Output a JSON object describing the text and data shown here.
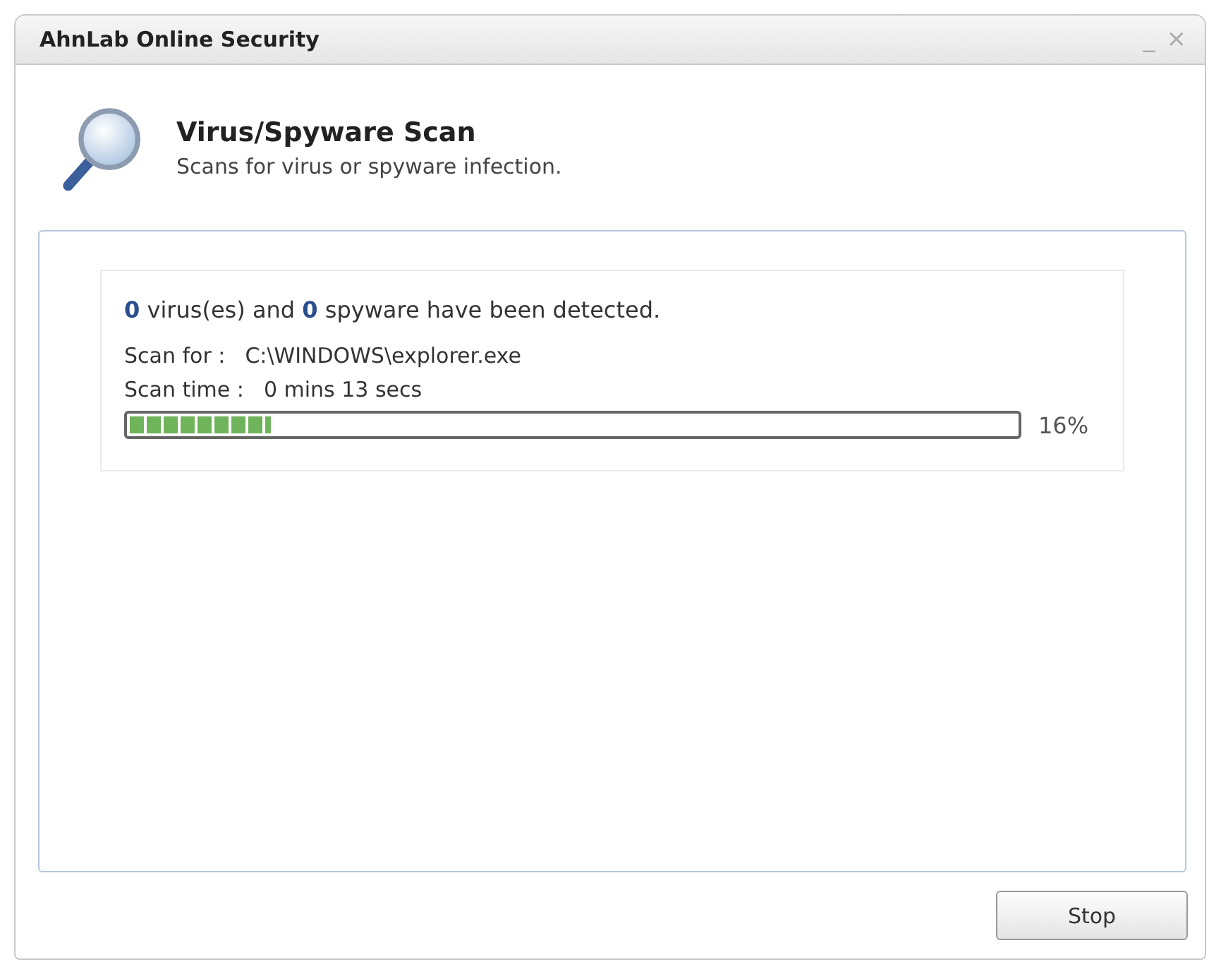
{
  "window": {
    "title": "AhnLab Online Security",
    "controls": [
      "_",
      "×"
    ]
  },
  "header": {
    "title": "Virus/Spyware Scan",
    "subtitle": "Scans for virus or spyware infection."
  },
  "scan": {
    "summary": "**0** virus(es) and **0** spyware have been detected.",
    "fields": [
      {
        "label": "Scan for :",
        "value": "C:\\WINDOWS\\explorer.exe"
      },
      {
        "label": "Scan time :",
        "value": "0 mins 13 secs"
      }
    ],
    "progress": {
      "level": 0.16,
      "reading": "16%"
    }
  },
  "buttons": [
    "Stop"
  ]
}
